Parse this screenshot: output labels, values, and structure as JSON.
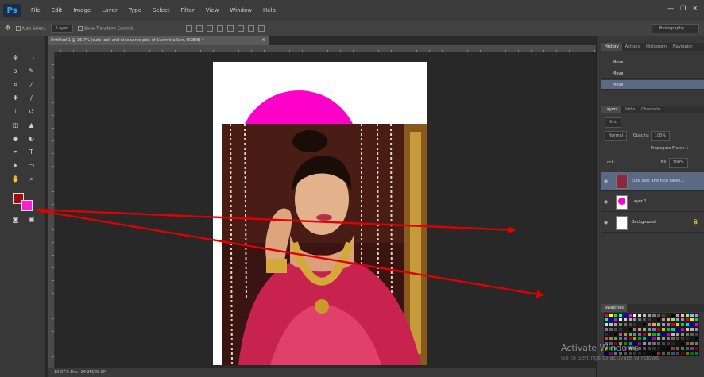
{
  "app": {
    "logo": "Ps"
  },
  "menu": [
    "File",
    "Edit",
    "Image",
    "Layer",
    "Type",
    "Select",
    "Filter",
    "View",
    "Window",
    "Help"
  ],
  "window_controls": [
    "—",
    "❐",
    "✕"
  ],
  "options_bar": {
    "tool_glyph": "✥",
    "auto_select_label": "Auto-Select:",
    "auto_select_value": "Layer",
    "show_transform_label": "Show Transform Controls",
    "workspace": "Photography"
  },
  "document_tab": {
    "title": "Untitled-1 @ 16.7% (cute look and nice saree pics of Sushmita Sen, RGB/8) *",
    "close": "×"
  },
  "status_bar": {
    "text": "16.67%    Doc: 24.9M/36.8M"
  },
  "colors": {
    "foreground": "#a30a0a",
    "background": "#ff1fd0",
    "accent_pink": "#ff00c8",
    "arrow": "#e00000"
  },
  "panels": {
    "history_tabs": [
      "History",
      "Actions",
      "Histogram",
      "Navigator"
    ],
    "history_items": [
      "Move",
      "Move",
      "Move"
    ],
    "layers_tabs": [
      "Layers",
      "Paths",
      "Channels"
    ],
    "layers_kind": "Kind",
    "blend_mode": "Normal",
    "opacity_label": "Opacity:",
    "opacity_value": "100%",
    "lock_label": "Lock:",
    "propagate_label": "Propagate Frame 1",
    "fill_label": "Fill:",
    "fill_value": "100%",
    "layers": [
      {
        "name": "cute look and nice saree...",
        "selected": true,
        "thumb": "photo"
      },
      {
        "name": "Layer 1",
        "selected": false,
        "thumb": "circle"
      },
      {
        "name": "Background",
        "selected": false,
        "thumb": "white",
        "lock": "🔒"
      }
    ],
    "swatches_tab": "Swatches"
  },
  "watermark": {
    "title": "Activate Windows",
    "sub": "Go to Settings to activate Windows."
  }
}
